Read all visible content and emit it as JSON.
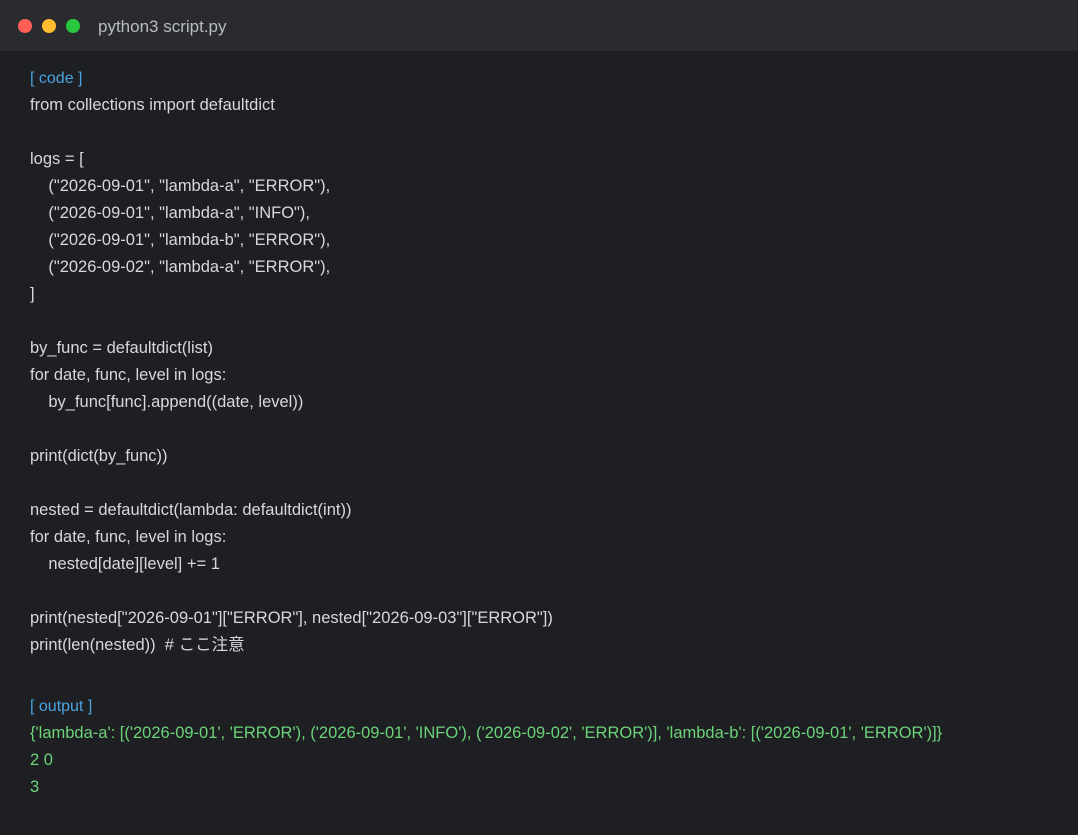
{
  "window": {
    "title": "python3 script.py"
  },
  "code_section": {
    "label": "[ code ]",
    "lines": [
      "from collections import defaultdict",
      "",
      "logs = [",
      "    (\"2026-09-01\", \"lambda-a\", \"ERROR\"),",
      "    (\"2026-09-01\", \"lambda-a\", \"INFO\"),",
      "    (\"2026-09-01\", \"lambda-b\", \"ERROR\"),",
      "    (\"2026-09-02\", \"lambda-a\", \"ERROR\"),",
      "]",
      "",
      "by_func = defaultdict(list)",
      "for date, func, level in logs:",
      "    by_func[func].append((date, level))",
      "",
      "print(dict(by_func))",
      "",
      "nested = defaultdict(lambda: defaultdict(int))",
      "for date, func, level in logs:",
      "    nested[date][level] += 1",
      "",
      "print(nested[\"2026-09-01\"][\"ERROR\"], nested[\"2026-09-03\"][\"ERROR\"])",
      "print(len(nested))  # ここ注意"
    ]
  },
  "output_section": {
    "label": "[ output ]",
    "lines": [
      "{'lambda-a': [('2026-09-01', 'ERROR'), ('2026-09-01', 'INFO'), ('2026-09-02', 'ERROR')], 'lambda-b': [('2026-09-01', 'ERROR')]}",
      "2 0",
      "3"
    ]
  },
  "colors": {
    "background": "#1e1f22",
    "titlebar": "#2a2b2e",
    "label": "#4aa3e0",
    "code_text": "#d6d8dc",
    "output_text": "#6bd37a"
  }
}
